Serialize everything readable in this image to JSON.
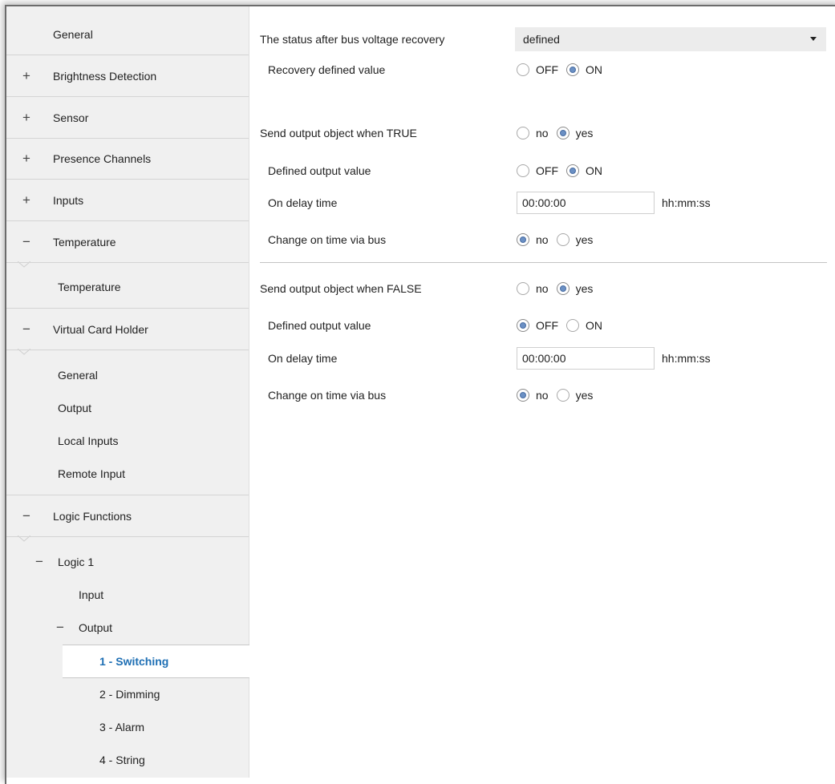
{
  "sidebar": {
    "top_items": [
      {
        "label": "General",
        "expander": ""
      },
      {
        "label": "Brightness Detection",
        "expander": "+"
      },
      {
        "label": "Sensor",
        "expander": "+"
      },
      {
        "label": "Presence Channels",
        "expander": "+"
      },
      {
        "label": "Inputs",
        "expander": "+"
      },
      {
        "label": "Temperature",
        "expander": "−"
      }
    ],
    "temperature_sub": "Temperature",
    "virtual_card_holder": {
      "label": "Virtual Card Holder",
      "expander": "−"
    },
    "vch_sub": [
      "General",
      "Output",
      "Local Inputs",
      "Remote Input"
    ],
    "logic_functions": {
      "label": "Logic Functions",
      "expander": "−"
    },
    "logic1": {
      "label": "Logic 1",
      "expander": "−"
    },
    "logic1_input": "Input",
    "logic1_output": {
      "label": "Output",
      "expander": "−"
    },
    "output_items": [
      "1 - Switching",
      "2 - Dimming",
      "3 - Alarm",
      "4 - String"
    ]
  },
  "params": {
    "status_after_recovery": {
      "label": "The status after bus voltage recovery",
      "value": "defined"
    },
    "recovery_defined_value": {
      "label": "Recovery defined value",
      "options": [
        "OFF",
        "ON"
      ],
      "selected": "ON"
    },
    "true_section": {
      "send": {
        "label": "Send output object when TRUE",
        "options": [
          "no",
          "yes"
        ],
        "selected": "yes"
      },
      "defined_value": {
        "label": "Defined output value",
        "options": [
          "OFF",
          "ON"
        ],
        "selected": "ON"
      },
      "on_delay": {
        "label": "On delay time",
        "value": "00:00:00",
        "unit": "hh:mm:ss"
      },
      "change_via_bus": {
        "label": "Change on time via bus",
        "options": [
          "no",
          "yes"
        ],
        "selected": "no"
      }
    },
    "false_section": {
      "send": {
        "label": "Send output object when FALSE",
        "options": [
          "no",
          "yes"
        ],
        "selected": "yes"
      },
      "defined_value": {
        "label": "Defined output value",
        "options": [
          "OFF",
          "ON"
        ],
        "selected": "OFF"
      },
      "on_delay": {
        "label": "On delay time",
        "value": "00:00:00",
        "unit": "hh:mm:ss"
      },
      "change_via_bus": {
        "label": "Change on time via bus",
        "options": [
          "no",
          "yes"
        ],
        "selected": "no"
      }
    }
  },
  "colors": {
    "accent": "#1e6fb4",
    "radio_dot": "#6b90c4",
    "sidebar_bg": "#f0f0f0"
  }
}
